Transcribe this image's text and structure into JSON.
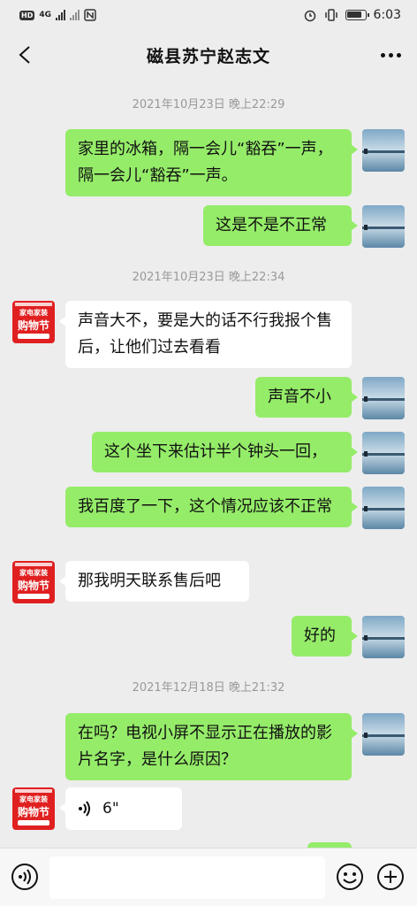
{
  "status_bar": {
    "hd_label": "HD",
    "network_label": "4G",
    "time": "6:03"
  },
  "header": {
    "title": "磁县苏宁赵志文"
  },
  "messages": [
    {
      "type": "time",
      "text": "2021年10月23日 晚上22:29"
    },
    {
      "type": "sent",
      "text": "家里的冰箱，隔一会儿“豁吞”一声，隔一会儿“豁吞”一声。"
    },
    {
      "type": "sent",
      "text": "这是不是不正常"
    },
    {
      "type": "time",
      "text": "2021年10月23日 晚上22:34"
    },
    {
      "type": "received",
      "text": "声音大不，要是大的话不行我报个售后，让他们过去看看"
    },
    {
      "type": "sent",
      "text": "声音不小"
    },
    {
      "type": "sent",
      "text": "这个坐下来估计半个钟头一回，"
    },
    {
      "type": "sent",
      "text": "我百度了一下，这个情况应该不正常"
    },
    {
      "type": "received",
      "text": "那我明天联系售后吧"
    },
    {
      "type": "sent",
      "text": "好的"
    },
    {
      "type": "time",
      "text": "2021年12月18日 晚上21:32"
    },
    {
      "type": "sent",
      "text": "在吗？电视小屏不显示正在播放的影片名字，是什么原因？"
    },
    {
      "type": "received_voice",
      "text": "6\""
    }
  ],
  "avatars": {
    "received": {
      "lines": [
        "家电家装",
        "购物节"
      ]
    }
  },
  "input_bar": {
    "placeholder": ""
  },
  "colors": {
    "sent_bubble": "#95ec69",
    "received_bubble": "#ffffff",
    "background": "#ededed"
  }
}
